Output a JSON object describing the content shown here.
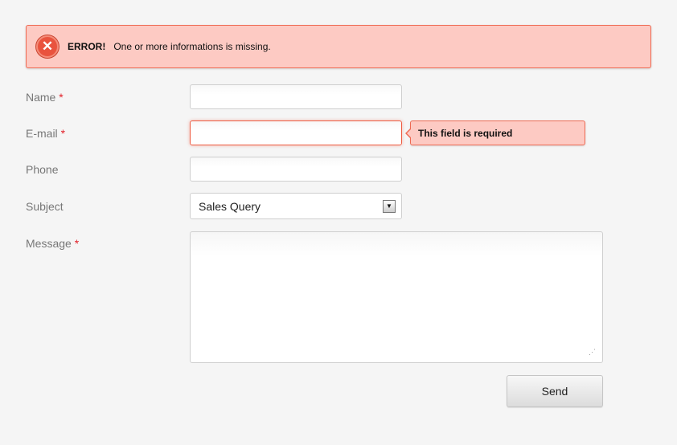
{
  "alert": {
    "icon": "error-x-icon",
    "title": "ERROR!",
    "message": "One or more informations is missing.",
    "bg": "#fdcac3",
    "border": "#ee6a53"
  },
  "form": {
    "name_label": "Name",
    "email_label": "E-mail",
    "phone_label": "Phone",
    "subject_label": "Subject",
    "message_label": "Message",
    "required_mark": "*",
    "name_value": "",
    "email_value": "",
    "phone_value": "",
    "message_value": "",
    "subject_value": "Sales Query",
    "email_error": "This field is required",
    "send_label": "Send"
  }
}
